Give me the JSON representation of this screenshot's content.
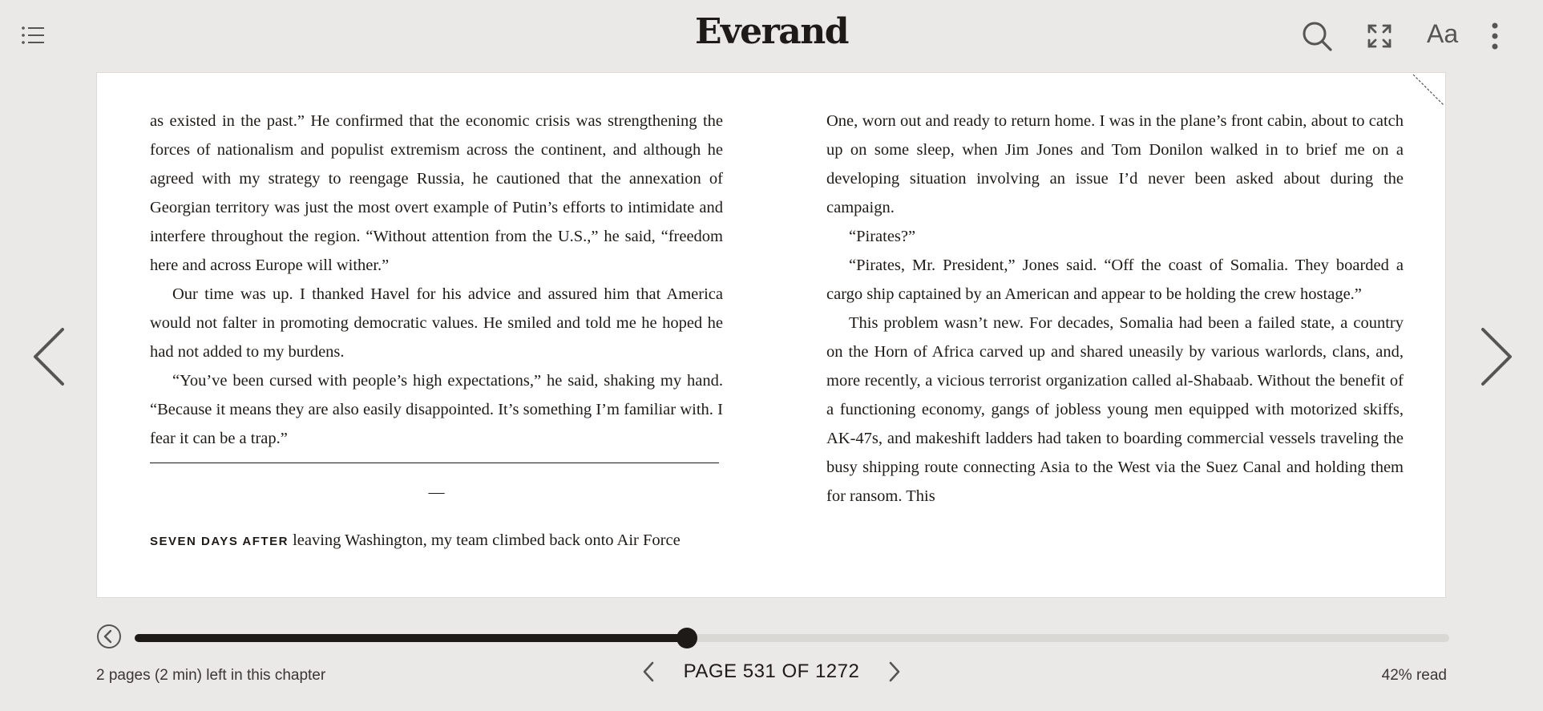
{
  "header": {
    "brand": "Everand",
    "icons": [
      "table-of-contents-icon",
      "search-icon",
      "fullscreen-icon",
      "text-settings-icon",
      "more-options-icon"
    ],
    "text_settings_label": "Aa"
  },
  "reader": {
    "left_column": {
      "paragraphs": [
        "as existed in the past.” He confirmed that the economic crisis was strength­ening the forces of nationalism and populist extremism across the continent, and although he agreed with my strategy to reengage Russia, he cautioned that the annexation of Georgian territory was just the most overt example of Putin’s efforts to intimidate and interfere throughout the region. “Without attention from the U.S.,” he said, “freedom here and across Europe will wither.”",
        "Our time was up. I thanked Havel for his advice and assured him that Amer­ica would not falter in promoting democratic values. He smiled and told me he hoped he had not added to my burdens.",
        "“You’ve been cursed with people’s high expectations,” he said, shaking my hand. “Because it means they are also easily disappointed. It’s something I’m familiar with. I fear it can be a trap.”"
      ],
      "section_break": "—",
      "lead_in": "SEVEN DAYS AFTER",
      "section_start": " leaving Washington, my team climbed back onto Air Force"
    },
    "right_column": {
      "paragraphs": [
        "One, worn out and ready to return home. I was in the plane’s front cabin, about to catch up on some sleep, when Jim Jones and Tom Donilon walked in to brief me on a developing situation involving an issue I’d never been asked about during the campaign.",
        "“Pirates?”",
        "“Pirates, Mr. President,” Jones said. “Off the coast of Somalia. They board­ed a cargo ship captained by an American and appear to be holding the crew hostage.”",
        "This problem wasn’t new. For decades, Somalia had been a failed state, a country on the Horn of Africa carved up and shared uneasily by various war­lords, clans, and, more recently, a vicious terrorist organization called al-Shabaab. Without the benefit of a functioning economy, gangs of jobless young men equipped with motorized skiffs, AK-47s, and makeshift ladders had taken to boarding commercial vessels traveling the busy shipping route con­necting Asia to the West via the Suez Canal and holding them for ransom. This"
      ]
    }
  },
  "footer": {
    "progress_fraction": 0.42,
    "chapter_remaining": "2 pages (2 min) left in this chapter",
    "page_label": "PAGE 531 OF 1272",
    "percent_read": "42% read"
  },
  "colors": {
    "background": "#eae9e7",
    "ink": "#1e1a17",
    "page": "#ffffff",
    "track": "#d9d8d5"
  }
}
